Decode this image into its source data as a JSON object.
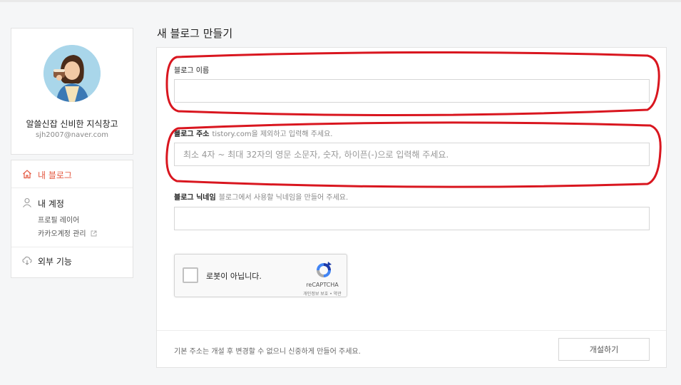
{
  "profile": {
    "name": "알쓸신잡 신비한 지식창고",
    "email": "sjh2007@naver.com"
  },
  "menu": {
    "my_blog": "내 블로그",
    "my_account": "내 계정",
    "profile_layer": "프로필 레이어",
    "kakao_account": "카카오계정 관리",
    "external": "외부 기능"
  },
  "page": {
    "title": "새 블로그 만들기"
  },
  "form": {
    "name_label": "블로그 이름",
    "name_value": "",
    "address_label": "블로그 주소",
    "address_hint": "tistory.com을 제외하고 입력해 주세요.",
    "address_placeholder": "최소 4자 ~ 최대 32자의 영문 소문자, 숫자, 하이픈(-)으로 입력해 주세요.",
    "nickname_label": "블로그 닉네임",
    "nickname_hint": "블로그에서 사용할 닉네임을 만들어 주세요.",
    "nickname_value": ""
  },
  "recaptcha": {
    "label": "로봇이 아닙니다.",
    "brand": "reCAPTCHA",
    "terms": "개인정보 보호 • 약관"
  },
  "footer": {
    "note": "기본 주소는 개설 후 변경할 수 없으니 신중하게 만들어 주세요.",
    "create_button": "개설하기"
  },
  "colors": {
    "accent": "#e4573f",
    "annotation": "#d9161f"
  }
}
